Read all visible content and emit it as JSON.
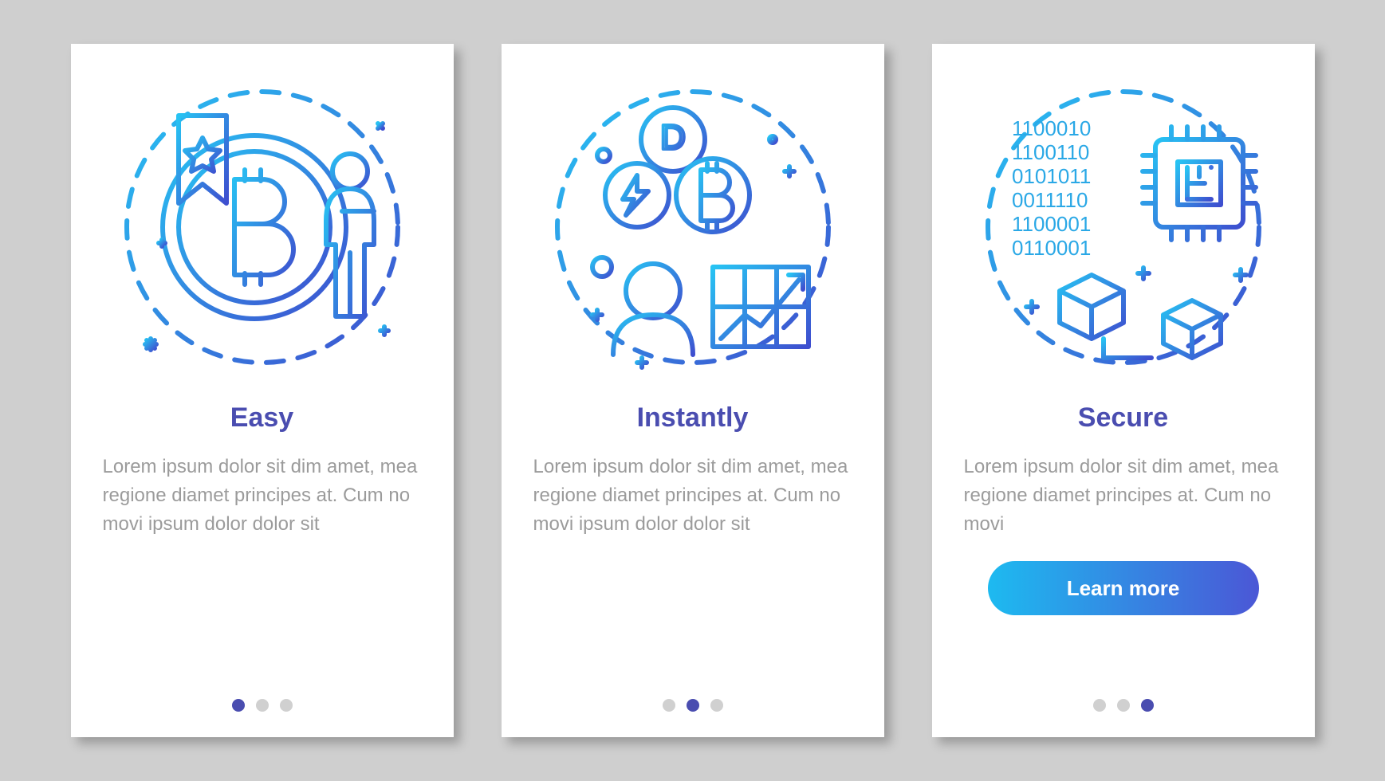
{
  "cards": [
    {
      "title": "Easy",
      "body": "Lorem ipsum dolor sit dim amet, mea regione diamet principes at. Cum no movi ipsum dolor dolor sit",
      "activeDot": 0,
      "hasButton": false
    },
    {
      "title": "Instantly",
      "body": "Lorem ipsum dolor sit dim amet, mea regione diamet principes at. Cum no movi ipsum dolor dolor sit",
      "activeDot": 1,
      "hasButton": false
    },
    {
      "title": "Secure",
      "body": "Lorem ipsum dolor sit dim amet, mea regione diamet principes at. Cum no movi",
      "activeDot": 2,
      "hasButton": true,
      "buttonLabel": "Learn more"
    }
  ],
  "colors": {
    "accent": "#4a4db0",
    "gradientStart": "#1dbaf0",
    "gradientEnd": "#4b57d6",
    "bodyText": "#9b9b9b",
    "background": "#cfcfcf"
  },
  "binaryMatrix": [
    "1100010",
    "1100110",
    "0101011",
    "0011110",
    "1100001",
    "0110001"
  ]
}
